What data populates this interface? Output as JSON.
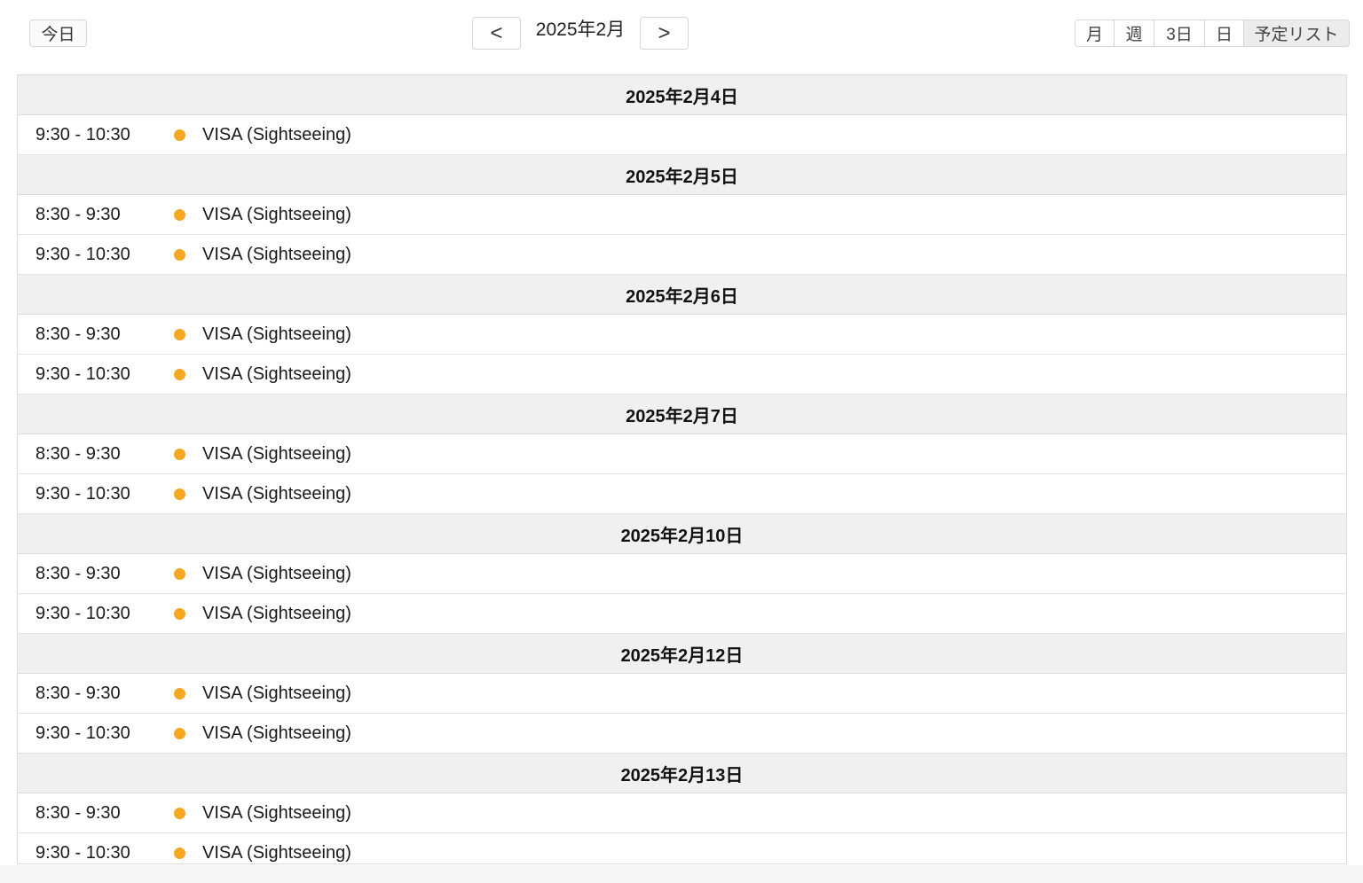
{
  "toolbar": {
    "today_label": "今日",
    "prev_label": "<",
    "next_label": ">",
    "title": "2025年2月",
    "views": [
      {
        "label": "月",
        "active": false
      },
      {
        "label": "週",
        "active": false
      },
      {
        "label": "3日",
        "active": false
      },
      {
        "label": "日",
        "active": false
      },
      {
        "label": "予定リスト",
        "active": true
      }
    ]
  },
  "accent_colors": {
    "event_dot": "#f5a623",
    "header_bg": "#f0f0f0"
  },
  "days": [
    {
      "date": "2025年2月4日",
      "events": [
        {
          "time": "9:30 - 10:30",
          "title": "VISA (Sightseeing)"
        }
      ]
    },
    {
      "date": "2025年2月5日",
      "events": [
        {
          "time": "8:30 - 9:30",
          "title": "VISA (Sightseeing)"
        },
        {
          "time": "9:30 - 10:30",
          "title": "VISA (Sightseeing)"
        }
      ]
    },
    {
      "date": "2025年2月6日",
      "events": [
        {
          "time": "8:30 - 9:30",
          "title": "VISA (Sightseeing)"
        },
        {
          "time": "9:30 - 10:30",
          "title": "VISA (Sightseeing)"
        }
      ]
    },
    {
      "date": "2025年2月7日",
      "events": [
        {
          "time": "8:30 - 9:30",
          "title": "VISA (Sightseeing)"
        },
        {
          "time": "9:30 - 10:30",
          "title": "VISA (Sightseeing)"
        }
      ]
    },
    {
      "date": "2025年2月10日",
      "events": [
        {
          "time": "8:30 - 9:30",
          "title": "VISA (Sightseeing)"
        },
        {
          "time": "9:30 - 10:30",
          "title": "VISA (Sightseeing)"
        }
      ]
    },
    {
      "date": "2025年2月12日",
      "events": [
        {
          "time": "8:30 - 9:30",
          "title": "VISA (Sightseeing)"
        },
        {
          "time": "9:30 - 10:30",
          "title": "VISA (Sightseeing)"
        }
      ]
    },
    {
      "date": "2025年2月13日",
      "events": [
        {
          "time": "8:30 - 9:30",
          "title": "VISA (Sightseeing)"
        },
        {
          "time": "9:30 - 10:30",
          "title": "VISA (Sightseeing)"
        }
      ]
    }
  ]
}
